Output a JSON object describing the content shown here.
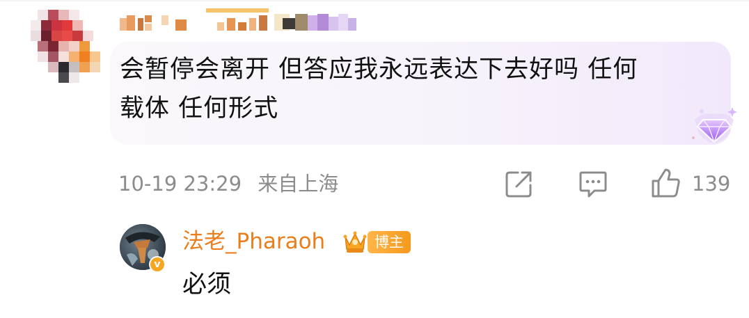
{
  "comment": {
    "avatar_icon": "pixelated-avatar",
    "username_icon": "pixelated-username",
    "text_line1": "会暂停会离开 但答应我永远表达下去好吗 任何",
    "text_line2": "载体 任何形式",
    "badge_icon": "purple-gem-badge-icon",
    "timestamp": "10-19 23:29",
    "location": "来自上海",
    "share_icon": "share-icon",
    "comment_icon": "comment-icon",
    "like_icon": "thumbs-up-icon",
    "like_count": "139"
  },
  "reply": {
    "name": "法老_Pharaoh",
    "crown_icon": "crown-icon",
    "badge_label": "博主",
    "verified_icon": "verified-v-icon",
    "verified_mark": "v",
    "text": "必须"
  },
  "colors": {
    "name_orange": "#ea7d1c",
    "meta_gray": "#8c8c8c",
    "badge_orange": "#f59a1e",
    "bubble_purple": "#f1e9fb"
  }
}
